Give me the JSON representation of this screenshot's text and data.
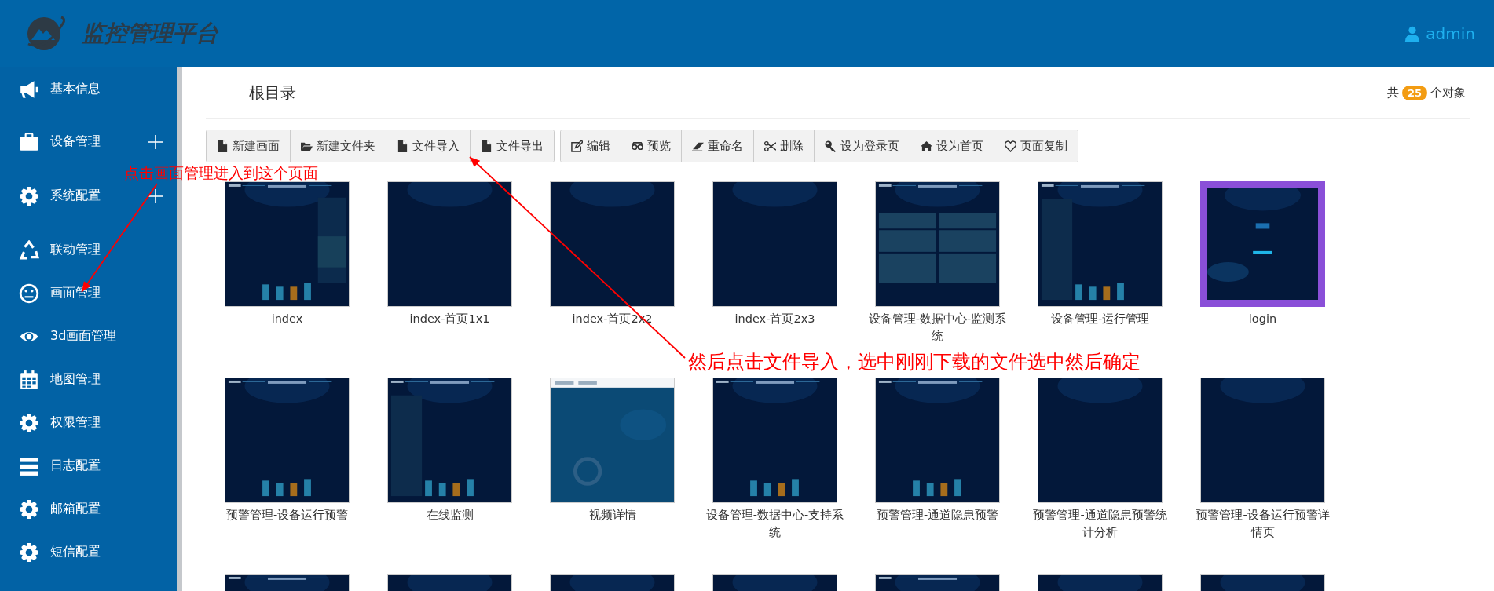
{
  "header": {
    "title": "监控管理平台",
    "user": "admin"
  },
  "sidebar": {
    "items": [
      {
        "label": "基本信息",
        "expandable": false
      },
      {
        "label": "设备管理",
        "expandable": true
      },
      {
        "label": "系统配置",
        "expandable": true
      },
      {
        "label": "联动管理",
        "expandable": false
      },
      {
        "label": "画面管理",
        "expandable": false
      },
      {
        "label": "3d画面管理",
        "expandable": false
      },
      {
        "label": "地图管理",
        "expandable": false
      },
      {
        "label": "权限管理",
        "expandable": false
      },
      {
        "label": "日志配置",
        "expandable": false
      },
      {
        "label": "邮箱配置",
        "expandable": false
      },
      {
        "label": "短信配置",
        "expandable": false
      }
    ]
  },
  "content": {
    "title": "根目录",
    "count_prefix": "共",
    "count": "25",
    "count_suffix": "个对象"
  },
  "toolbar": {
    "groups": [
      [
        "新建画面",
        "新建文件夹",
        "文件导入",
        "文件导出"
      ],
      [
        "编辑",
        "预览",
        "重命名",
        "删除",
        "设为登录页",
        "设为首页",
        "页面复制"
      ]
    ]
  },
  "pages": [
    {
      "name": "index",
      "selected": false
    },
    {
      "name": "index-首页1x1",
      "selected": false
    },
    {
      "name": "index-首页2x2",
      "selected": false
    },
    {
      "name": "index-首页2x3",
      "selected": false
    },
    {
      "name": "设备管理-数据中心-监测系统",
      "selected": false
    },
    {
      "name": "设备管理-运行管理",
      "selected": false
    },
    {
      "name": "login",
      "selected": true
    },
    {
      "name": "预警管理-设备运行预警",
      "selected": false
    },
    {
      "name": "在线监测",
      "selected": false
    },
    {
      "name": "视频详情",
      "selected": false
    },
    {
      "name": "设备管理-数据中心-支持系统",
      "selected": false
    },
    {
      "name": "预警管理-通道隐患预警",
      "selected": false
    },
    {
      "name": "预警管理-通道隐患预警统计分析",
      "selected": false
    },
    {
      "name": "预警管理-设备运行预警详情页",
      "selected": false
    },
    {
      "selected": false
    },
    {
      "selected": false
    },
    {
      "selected": false
    },
    {
      "selected": false
    },
    {
      "selected": false
    },
    {
      "selected": false
    },
    {
      "selected": false
    }
  ],
  "annotations": [
    {
      "text": "点击画面管理进入到这个页面"
    },
    {
      "text": "然后点击文件导入，选中刚刚下载的文件选中然后确定"
    }
  ]
}
